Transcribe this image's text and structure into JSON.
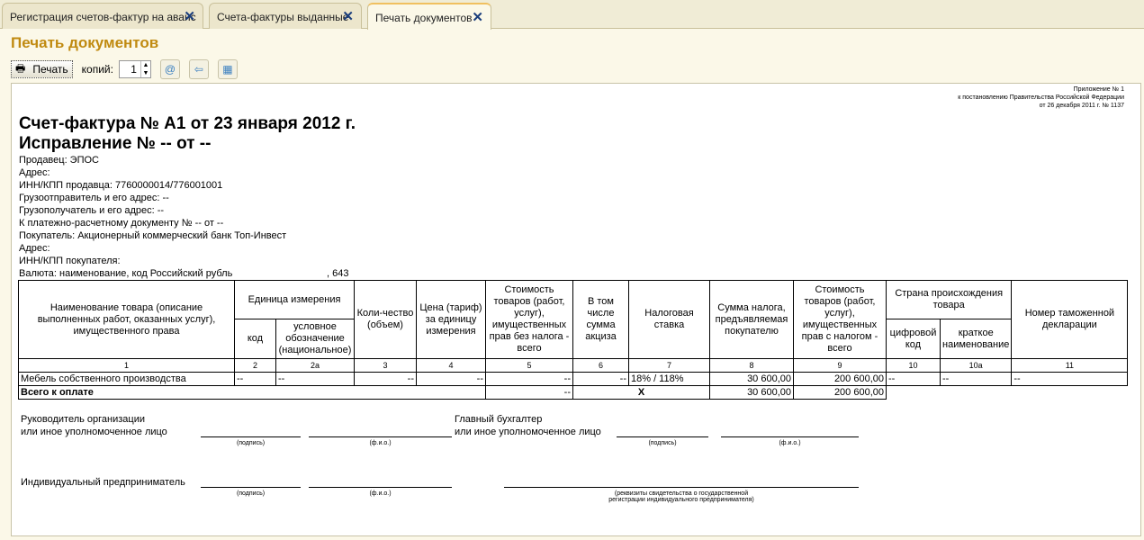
{
  "tabs": [
    {
      "label": "Регистрация счетов-фактур на аванс"
    },
    {
      "label": "Счета-фактуры выданные"
    },
    {
      "label": "Печать документов"
    }
  ],
  "form_title": "Печать документов",
  "toolbar": {
    "print_label": "Печать",
    "copies_label": "копий:",
    "copies_value": "1"
  },
  "appendix": [
    "Приложение № 1",
    "к постановлению Правительства Российской Федерации",
    "от 26 декабря 2011 г. № 1137"
  ],
  "invoice_title": "Счет-фактура № А1 от 23 января 2012 г.",
  "correction_title": "Исправление № -- от --",
  "info_lines": [
    "Продавец: ЭПОС",
    "Адрес:",
    "ИНН/КПП продавца: 7760000014/776001001",
    "Грузоотправитель и его адрес: --",
    "Грузополучатель и его адрес: --",
    "К платежно-расчетному документу № -- от --",
    "Покупатель: Акционерный коммерческий банк Топ-Инвест",
    "Адрес:",
    "ИНН/КПП покупателя:"
  ],
  "currency": {
    "label": "Валюта: наименование, код Российский рубль",
    "code": ", 643"
  },
  "table": {
    "headers": {
      "name": "Наименование товара (описание выполненных работ, оказанных услуг), имущественного права",
      "unit": "Единица измерения",
      "unit_code": "код",
      "unit_symbol": "условное обозначение (национальное)",
      "qty": "Коли-чество (объем)",
      "price": "Цена (тариф) за единицу измерения",
      "cost_no_tax": "Стоимость товаров (работ, услуг), имущественных прав без налога - всего",
      "excise": "В том числе сумма акциза",
      "tax_rate": "Налоговая ставка",
      "tax_sum": "Сумма налога, предъявляемая покупателю",
      "cost_with_tax": "Стоимость товаров (работ, услуг), имущественных прав с налогом - всего",
      "country": "Страна происхождения товара",
      "country_code": "цифровой код",
      "country_name": "краткое наименование",
      "customs": "Номер таможенной декларации"
    },
    "col_numbers": [
      "1",
      "2",
      "2а",
      "3",
      "4",
      "5",
      "6",
      "7",
      "8",
      "9",
      "10",
      "10а",
      "11"
    ],
    "rows": [
      [
        "Мебель собственного производства",
        "--",
        "--",
        "--",
        "--",
        "--",
        "--",
        "18% / 118%",
        "30 600,00",
        "200 600,00",
        "--",
        "--",
        "--"
      ]
    ],
    "total": {
      "label": "Всего к оплате",
      "cost_no_tax": "--",
      "tax_rate": "X",
      "tax_sum": "30 600,00",
      "cost_with_tax": "200 600,00"
    }
  },
  "signatures": {
    "head": [
      "Руководитель организации",
      "или иное уполномоченное лицо"
    ],
    "accountant": [
      "Главный бухгалтер",
      "или иное уполномоченное лицо"
    ],
    "entrepreneur": "Индивидуальный предприниматель",
    "sign_cap": "(подпись)",
    "fio_cap": "(ф.и.о.)",
    "reg_cap": [
      "(реквизиты свидетельства о государственной",
      "регистрации индивидуального предпринимателя)"
    ]
  }
}
